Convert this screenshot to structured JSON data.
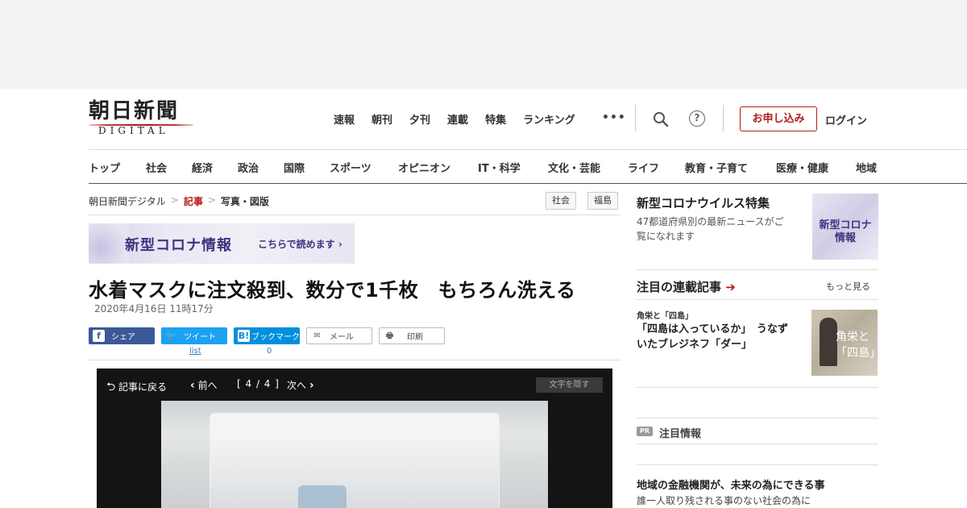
{
  "header": {
    "logo_kanji": "朝日新聞",
    "logo_sub": "DIGITAL",
    "top_nav": [
      "速報",
      "朝刊",
      "夕刊",
      "連載",
      "特集",
      "ランキング"
    ],
    "more": "•••",
    "apply_button": "お申し込み",
    "login": "ログイン"
  },
  "category_nav": [
    "トップ",
    "社会",
    "経済",
    "政治",
    "国際",
    "スポーツ",
    "オピニオン",
    "IT・科学",
    "文化・芸能",
    "ライフ",
    "教育・子育て",
    "医療・健康",
    "地域"
  ],
  "breadcrumb": {
    "home": "朝日新聞デジタル",
    "sep": ">",
    "current": "記事",
    "page": "写真・図版"
  },
  "tags": [
    "社会",
    "福島"
  ],
  "corona_banner": {
    "title": "新型コロナ情報",
    "cta": "こちらで読めます ›"
  },
  "article": {
    "headline": "水着マスクに注文殺到、数分で1千枚　もちろん洗える",
    "date": "2020年4月16日 11時17分"
  },
  "share": {
    "facebook": "シェア",
    "twitter": "ツイート",
    "hatena": "ブックマーク",
    "mail": "メール",
    "print": "印刷",
    "twitter_count": "list",
    "hatena_count": "0",
    "colors": {
      "facebook": "#3b5998",
      "twitter": "#1da1f2",
      "hatena": "#008fde"
    }
  },
  "photo_viewer": {
    "back": "記事に戻る",
    "prev": "前へ",
    "counter": "[ 4 / 4 ]",
    "next": "次へ",
    "hide_text": "文字を隠す"
  },
  "sidebar": {
    "corona": {
      "title": "新型コロナウイルス特集",
      "desc_line1": "47都道府県別の最新ニュースがご",
      "desc_line2": "覧になれます",
      "thumb_line1": "新型コロナ",
      "thumb_line2": "情報"
    },
    "series": {
      "title": "注目の連載記事",
      "arrow": "➔",
      "more": "もっと見る",
      "label": "角栄と「四島」",
      "head_line1": "「四島は入っているか」　うなず",
      "head_line2": "いたブレジネフ「ダー」",
      "thumb_line1": "角栄と",
      "thumb_line2": "「四島」"
    },
    "pr": {
      "badge": "PR",
      "title": "注目情報",
      "ad_head": "地域の金融機関が、未来の為にできる事",
      "ad_sub": "誰一人取り残される事のない社会の為に"
    }
  }
}
